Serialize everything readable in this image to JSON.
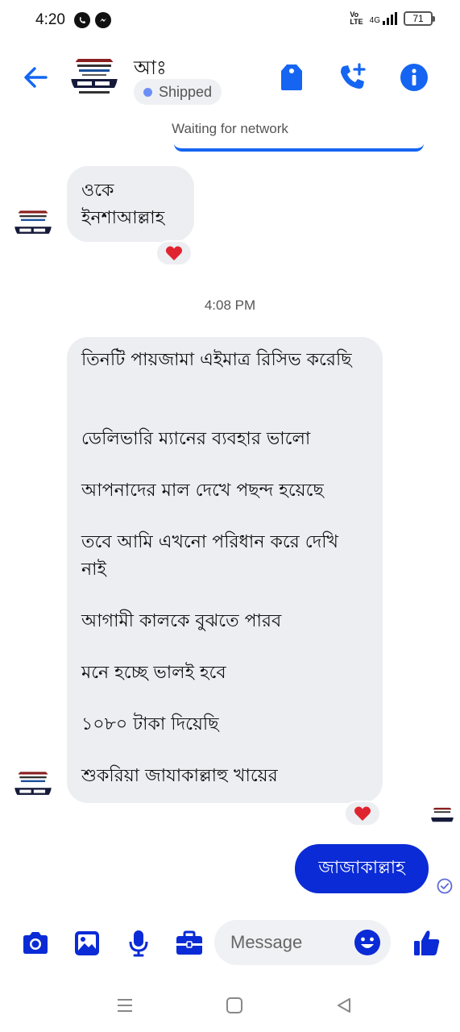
{
  "status_bar": {
    "time": "4:20",
    "network_type": "4G",
    "volte": "Vo LTE",
    "battery": "71"
  },
  "header": {
    "contact_name": "আঃ",
    "status_label": "Shipped",
    "icons": [
      "back-arrow-icon",
      "tag-icon",
      "add-call-icon",
      "info-icon"
    ]
  },
  "network_status": "Waiting for network",
  "messages": [
    {
      "text": "ওকে\nইনশাআল্লাহ",
      "reaction": "❤️"
    },
    {
      "timestamp": "4:08 PM"
    },
    {
      "lines": [
        "তিনটি পায়জামা এইমাত্র রিসিভ করেছি",
        " ডেলিভারি ম্যানের ব্যবহার ভালো",
        " আপনাদের মাল দেখে পছন্দ হয়েছে",
        "তবে আমি এখনো পরিধান করে দেখি নাই",
        "আগামী কালকে বুঝতে পারব",
        "মনে হচ্ছে ভালই হবে",
        "১০৮০ টাকা দিয়েছি",
        "শুকরিয়া জাযাকাল্লাহু খায়ের"
      ],
      "reaction": "❤️"
    },
    {
      "text": "জাজাকাল্লাহ",
      "outgoing": true
    }
  ],
  "composer": {
    "placeholder": "Message"
  },
  "colors": {
    "accent": "#1565f2",
    "outgoing_bubble": "#0a2bd6",
    "incoming_bubble": "#eceef2",
    "heart": "#e0242f"
  }
}
